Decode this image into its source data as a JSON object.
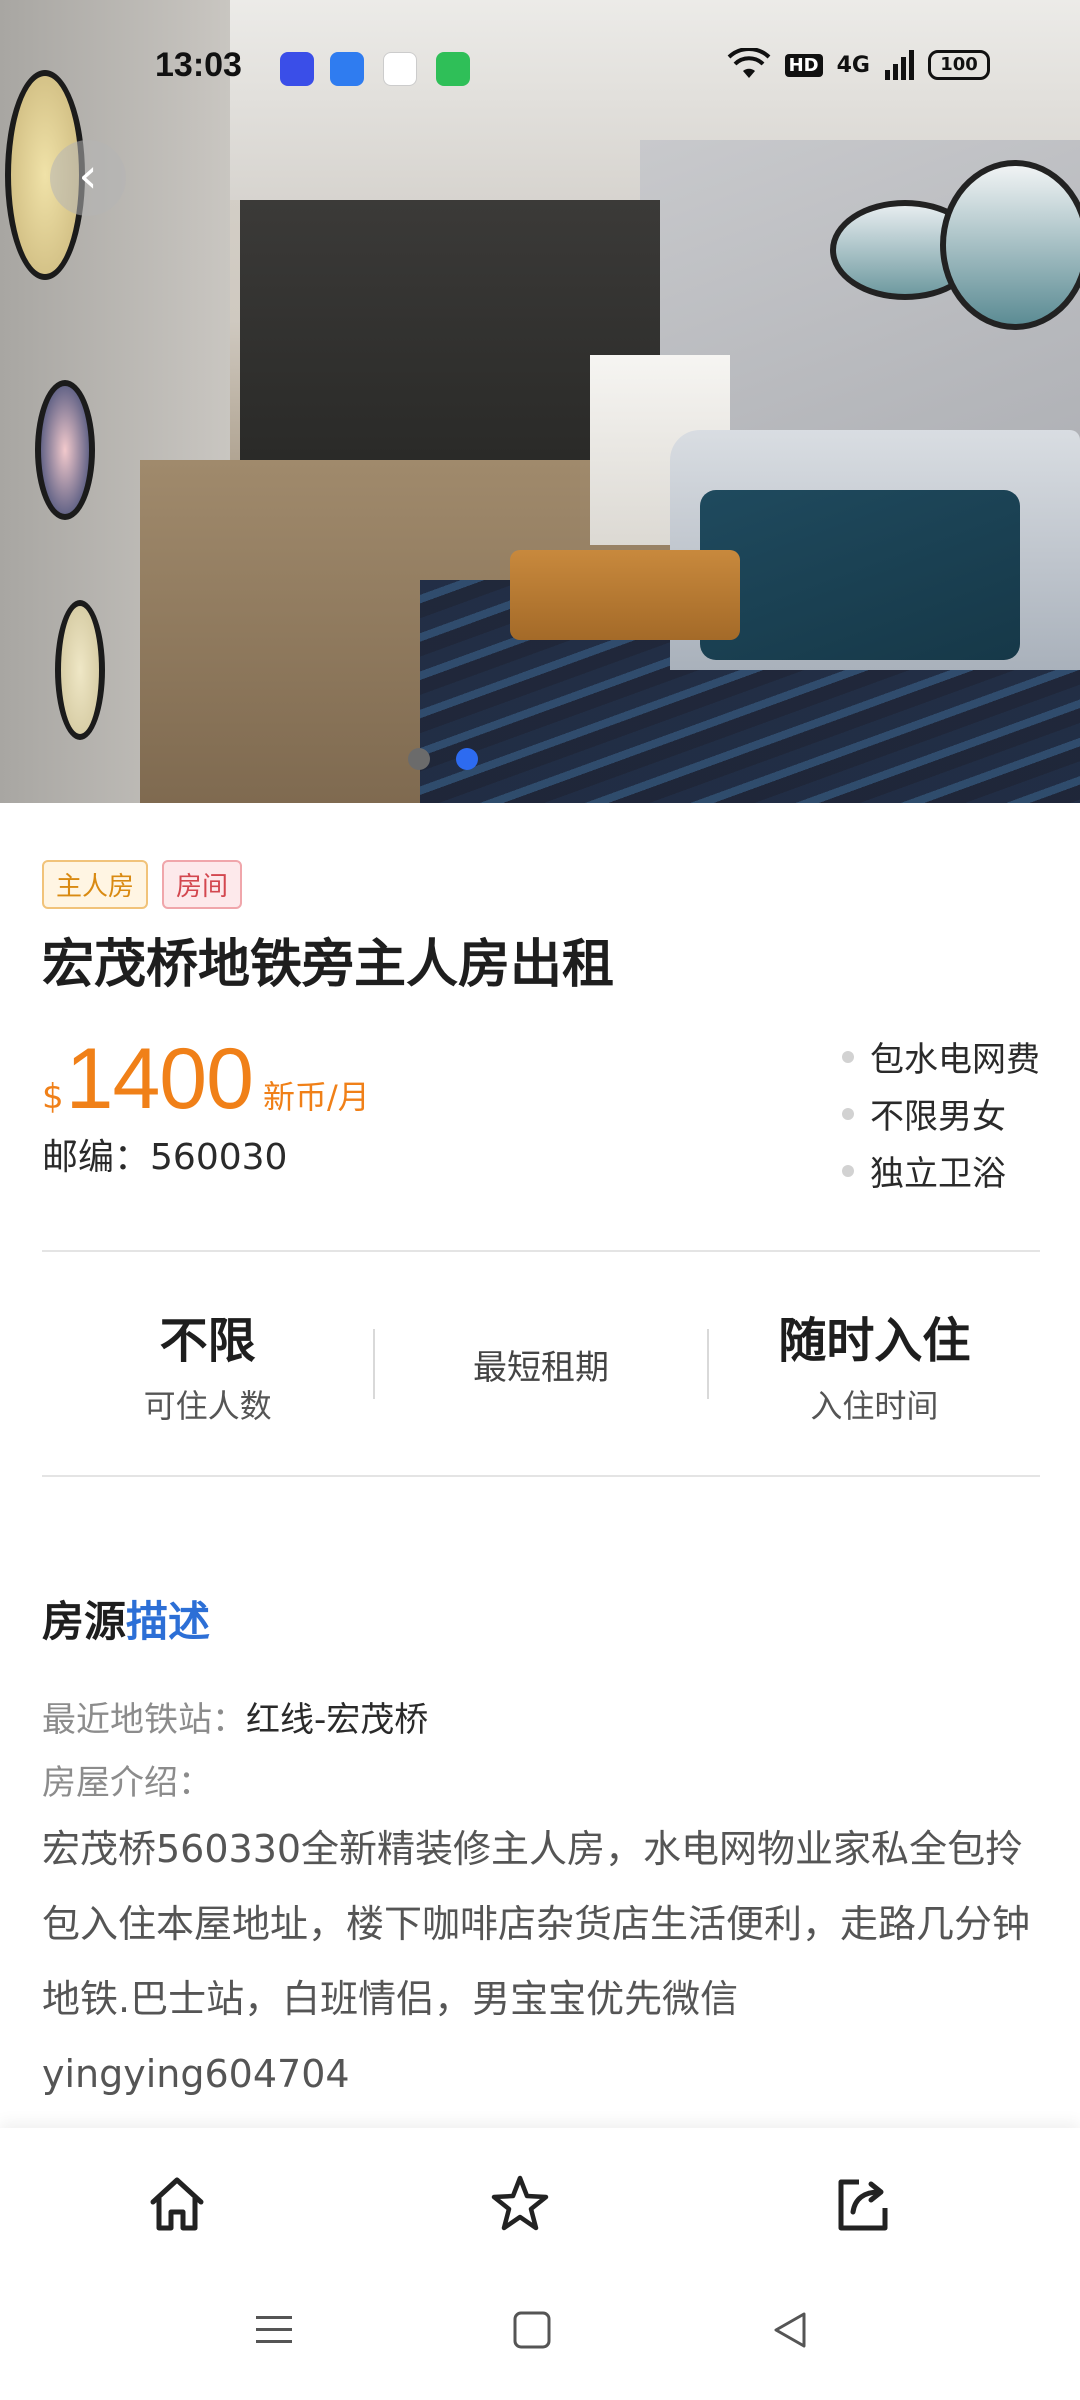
{
  "status_bar": {
    "time": "13:03",
    "hd_label": "HD",
    "network_label": "4G",
    "battery": "100"
  },
  "listing": {
    "tags": [
      "主人房",
      "房间"
    ],
    "title": "宏茂桥地铁旁主人房出租",
    "price_currency": "$",
    "price_amount": "1400",
    "price_unit": "新币/月",
    "postcode_label": "邮编：",
    "postcode_value": "560030",
    "features": [
      "包水电网费",
      "不限男女",
      "独立卫浴"
    ],
    "carousel": {
      "total": 2,
      "active_index": 1
    }
  },
  "stats": {
    "occupants_value": "不限",
    "occupants_label": "可住人数",
    "min_lease_label": "最短租期",
    "move_in_value": "随时入住",
    "move_in_label": "入住时间"
  },
  "description": {
    "section_title_main": "房源",
    "section_title_highlight": "描述",
    "metro_label": "最近地铁站：",
    "metro_value": "红线-宏茂桥",
    "intro_label": "房屋介绍：",
    "body": "宏茂桥560330全新精装修主人房，水电网物业家私全包拎包入住本屋地址，楼下咖啡店杂货店生活便利，走路几分钟地铁.巴士站，白班情侣，男宝宝优先微信yingying604704"
  },
  "icons": {
    "back": "chevron-left-icon",
    "home": "home-icon",
    "favorite": "star-icon",
    "share": "share-icon",
    "menu": "menu-icon",
    "recent": "square-icon",
    "nav_back": "triangle-back-icon"
  },
  "colors": {
    "price": "#f08018",
    "accent_blue": "#2c6fd6",
    "tag_orange": "#d98a12",
    "tag_red": "#d3474f"
  }
}
